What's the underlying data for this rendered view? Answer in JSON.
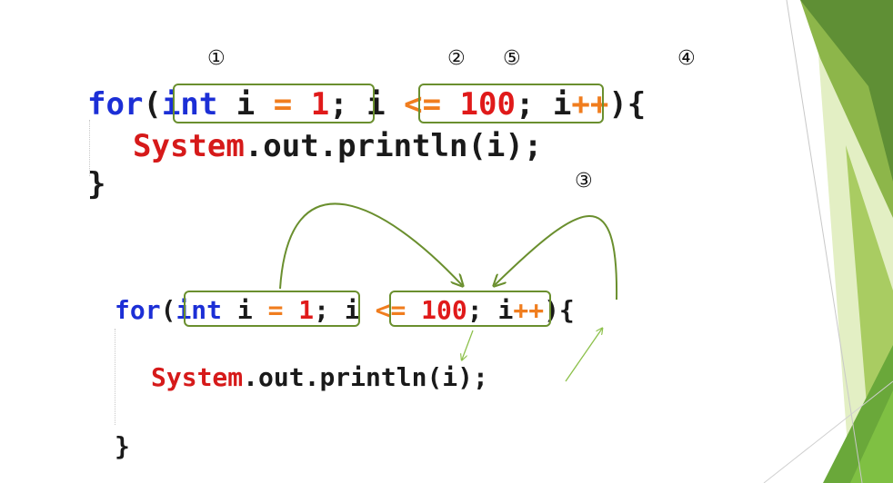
{
  "markers": {
    "m1": "①",
    "m2": "②",
    "m5": "⑤",
    "m4": "④",
    "m3": "③"
  },
  "top_code": {
    "line1": {
      "for": "for",
      "paren_open": "(",
      "int": "int",
      "var": " i ",
      "eq": "=",
      "one": " 1",
      "semi1": "; ",
      "cond_var": "i ",
      "le": "<=",
      "hundred": " 100",
      "semi2": "; ",
      "inc_var": "i",
      "inc_op": "++",
      "paren_close": "){"
    },
    "line2": {
      "system": "System",
      "rest": ".out.println(i);"
    },
    "line3": {
      "brace": "}"
    }
  },
  "bottom_code": {
    "line1": {
      "for": "for",
      "paren_open": "(",
      "int": "int",
      "var": " i ",
      "eq": "=",
      "one": " 1",
      "semi1": "; ",
      "cond_var": "i ",
      "le": "<=",
      "hundred": " 100",
      "semi2": "; ",
      "inc_var": "i",
      "inc_op": "++",
      "paren_close": "){"
    },
    "line2": {
      "system": "System",
      "rest": ".out.println(i);"
    },
    "line3": {
      "brace": "}"
    }
  },
  "colors": {
    "keyword": "#1c2fd6",
    "number": "#e01a1a",
    "operator": "#f07d1e",
    "class": "#d61a1a",
    "box_border": "#6a8f2e",
    "arrow": "#6a8f2e",
    "deco_dark": "#4f8a2b",
    "deco_light": "#cfe39a"
  }
}
